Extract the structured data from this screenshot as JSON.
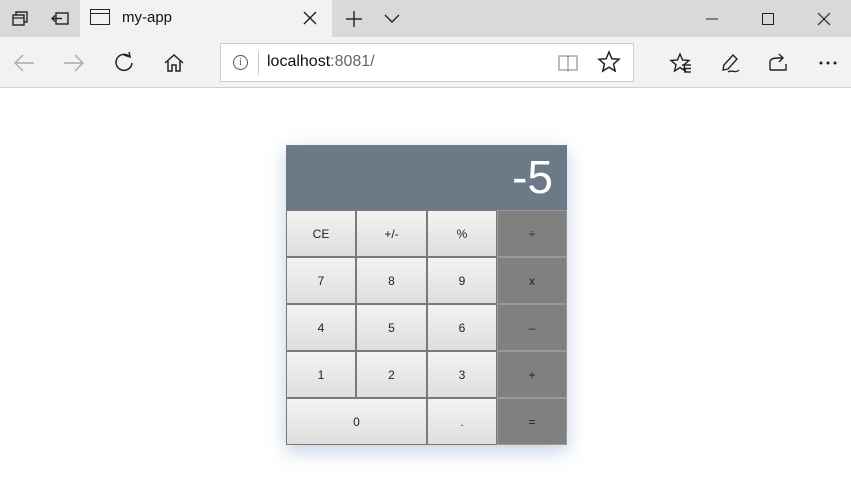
{
  "browser": {
    "tab_title": "my-app",
    "url_host": "localhost",
    "url_rest": ":8081/",
    "icons": {
      "tab_actions": "tab-actions-icon",
      "set_aside": "set-aside-tabs-icon",
      "new_tab": "plus-icon",
      "tab_list": "chevron-down-icon",
      "back": "arrow-left-icon",
      "forward": "arrow-right-icon",
      "refresh": "refresh-icon",
      "home": "home-icon",
      "info": "info-icon",
      "reading_view": "book-icon",
      "favorite": "star-icon",
      "favorites_hub": "favorites-icon",
      "notes": "pen-icon",
      "share": "share-icon",
      "more": "more-icon"
    }
  },
  "calculator": {
    "display": "-5",
    "colors": {
      "display_bg": "#6c7a88",
      "operator_bg": "#808080"
    },
    "keys": {
      "ce": "CE",
      "sign": "+/-",
      "percent": "%",
      "divide": "÷",
      "seven": "7",
      "eight": "8",
      "nine": "9",
      "multiply": "x",
      "four": "4",
      "five": "5",
      "six": "6",
      "subtract": "–",
      "one": "1",
      "two": "2",
      "three": "3",
      "add": "+",
      "zero": "0",
      "decimal": ".",
      "equals": "="
    }
  }
}
